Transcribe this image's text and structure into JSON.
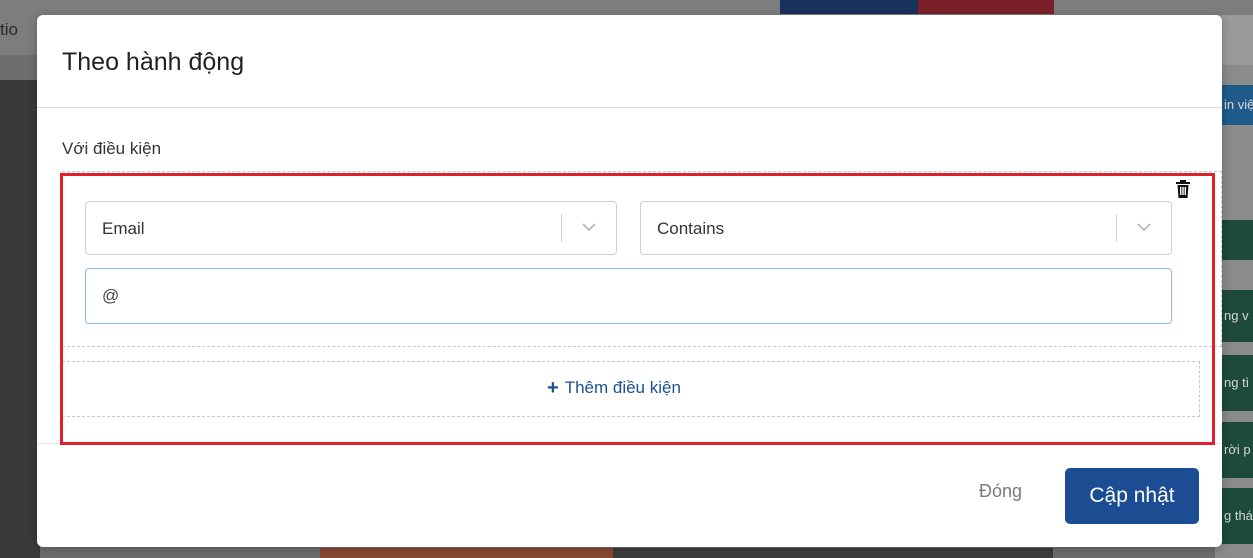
{
  "background": {
    "tab_text": "tio",
    "right_tiles": [
      "in việ",
      "ng v",
      "ng tì",
      "rời p",
      "g thá"
    ]
  },
  "modal": {
    "title": "Theo hành động",
    "condition_label": "Với điều kiện",
    "field_select": {
      "value": "Email"
    },
    "operator_select": {
      "value": "Contains"
    },
    "value_input": {
      "value": "@"
    },
    "add_condition_label": "Thêm điều kiện",
    "close_label": "Đóng",
    "update_label": "Cập nhật"
  },
  "colors": {
    "primary": "#1c4d93",
    "link": "#1d4f91",
    "highlight": "#e0202f",
    "input_focus_border": "#8fb8ea"
  },
  "icons": {
    "delete": "trash-icon",
    "dropdown": "chevron-down-icon",
    "add": "plus-icon"
  }
}
